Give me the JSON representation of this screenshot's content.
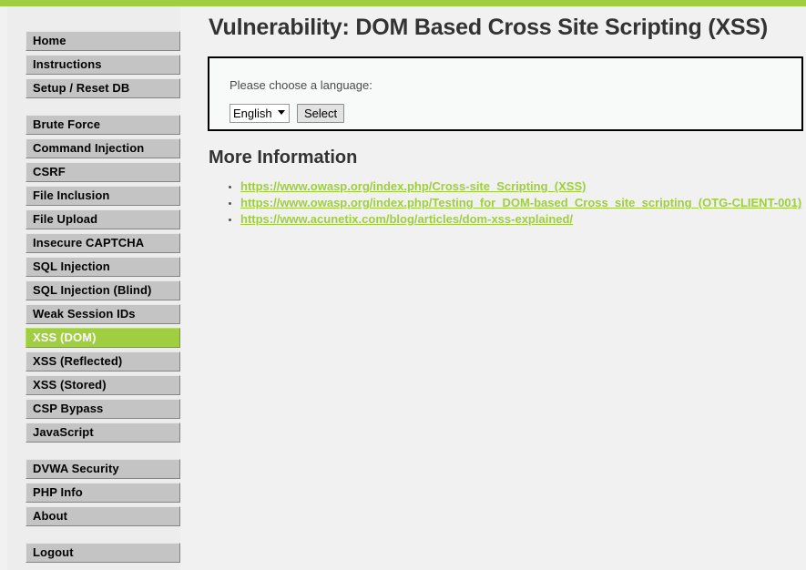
{
  "theme": {
    "accent_green": "#9fce40",
    "nav_button_bg": "#c4c4c4",
    "page_bg": "#f1f1f1",
    "sidebar_bg": "#ededed"
  },
  "sidebar": {
    "groups": [
      {
        "items": [
          {
            "label": "Home",
            "selected": false
          },
          {
            "label": "Instructions",
            "selected": false
          },
          {
            "label": "Setup / Reset DB",
            "selected": false
          }
        ]
      },
      {
        "items": [
          {
            "label": "Brute Force",
            "selected": false
          },
          {
            "label": "Command Injection",
            "selected": false
          },
          {
            "label": "CSRF",
            "selected": false
          },
          {
            "label": "File Inclusion",
            "selected": false
          },
          {
            "label": "File Upload",
            "selected": false
          },
          {
            "label": "Insecure CAPTCHA",
            "selected": false
          },
          {
            "label": "SQL Injection",
            "selected": false
          },
          {
            "label": "SQL Injection (Blind)",
            "selected": false
          },
          {
            "label": "Weak Session IDs",
            "selected": false
          },
          {
            "label": "XSS (DOM)",
            "selected": true
          },
          {
            "label": "XSS (Reflected)",
            "selected": false
          },
          {
            "label": "XSS (Stored)",
            "selected": false
          },
          {
            "label": "CSP Bypass",
            "selected": false
          },
          {
            "label": "JavaScript",
            "selected": false
          }
        ]
      },
      {
        "items": [
          {
            "label": "DVWA Security",
            "selected": false
          },
          {
            "label": "PHP Info",
            "selected": false
          },
          {
            "label": "About",
            "selected": false
          }
        ]
      },
      {
        "items": [
          {
            "label": "Logout",
            "selected": false
          }
        ]
      }
    ]
  },
  "main": {
    "page_title": "Vulnerability: DOM Based Cross Site Scripting (XSS)",
    "vuln_box": {
      "prompt": "Please choose a language:",
      "select": {
        "selected_value": "English",
        "options": [
          "English"
        ]
      },
      "submit_label": "Select"
    },
    "more_information": {
      "heading": "More Information",
      "links": [
        "https://www.owasp.org/index.php/Cross-site_Scripting_(XSS)",
        "https://www.owasp.org/index.php/Testing_for_DOM-based_Cross_site_scripting_(OTG-CLIENT-001)",
        "https://www.acunetix.com/blog/articles/dom-xss-explained/"
      ]
    }
  }
}
